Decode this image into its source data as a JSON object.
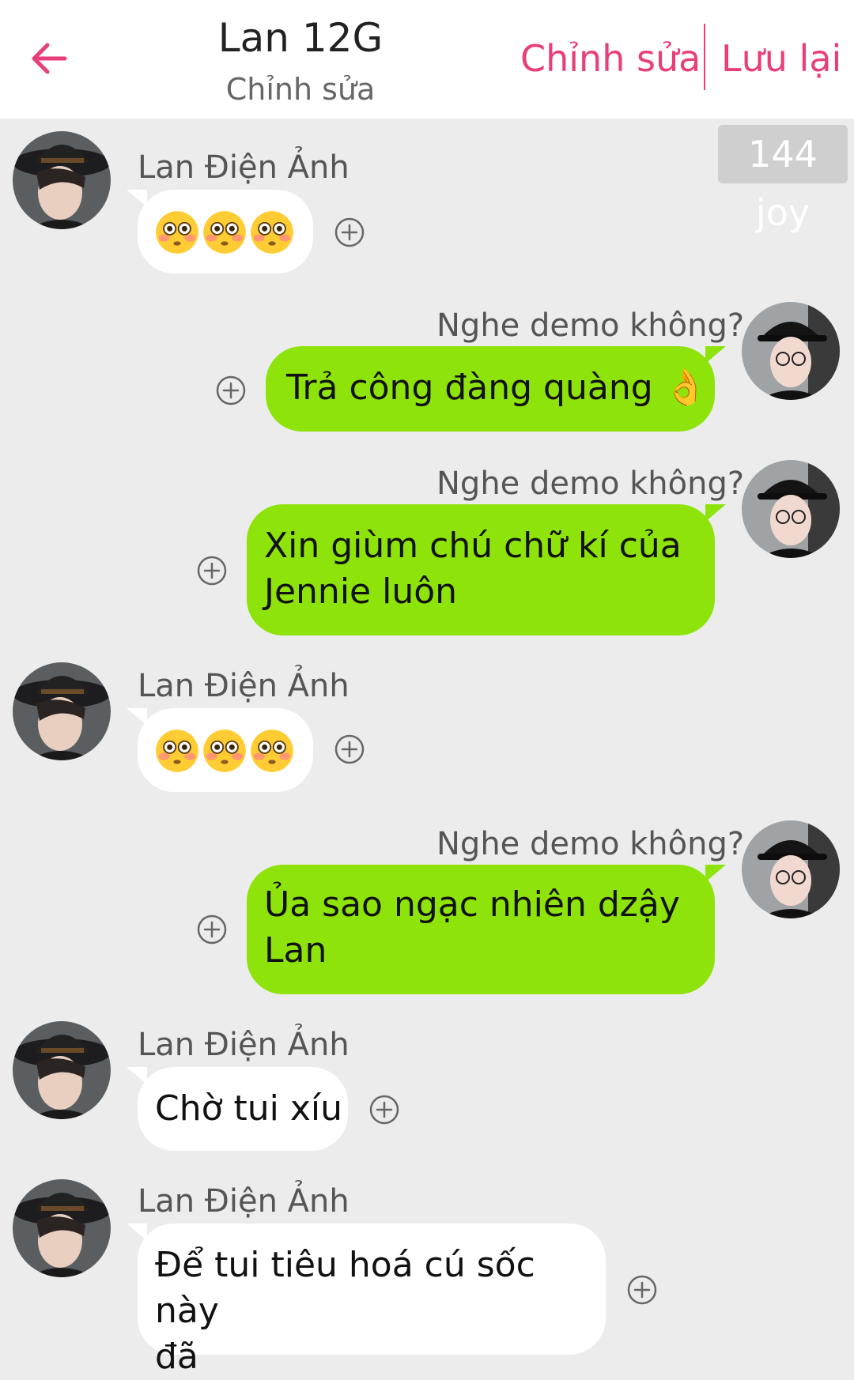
{
  "header": {
    "title": "Lan 12G",
    "subtitle": "Chỉnh sửa",
    "edit_label": "Chỉnh sửa",
    "save_label": "Lưu lại",
    "accent_color": "#e83e7a"
  },
  "badge": {
    "text": "144 joy"
  },
  "colors": {
    "background": "#ececec",
    "incoming_bubble": "#ffffff",
    "outgoing_bubble": "#8de30a"
  },
  "messages": [
    {
      "direction": "incoming",
      "sender": "Lan Điện Ảnh",
      "text": "😳😳😳",
      "emoji": "flushed-face",
      "count": 3
    },
    {
      "direction": "outgoing",
      "sender": "Nghe demo không?",
      "text": "Trả công đàng quàng 👌"
    },
    {
      "direction": "outgoing",
      "sender": "Nghe demo không?",
      "lines": [
        "Xin giùm chú chữ kí của",
        "Jennie luôn"
      ]
    },
    {
      "direction": "incoming",
      "sender": "Lan Điện Ảnh",
      "text": "😳😳😳",
      "emoji": "flushed-face",
      "count": 3
    },
    {
      "direction": "outgoing",
      "sender": "Nghe demo không?",
      "lines": [
        "Ủa sao ngạc nhiên dzậy",
        "Lan"
      ]
    },
    {
      "direction": "incoming",
      "sender": "Lan Điện Ảnh",
      "text": "Chờ tui xíu"
    },
    {
      "direction": "incoming",
      "sender": "Lan Điện Ảnh",
      "lines": [
        "Để tui tiêu hoá cú sốc này",
        "đã"
      ]
    }
  ]
}
